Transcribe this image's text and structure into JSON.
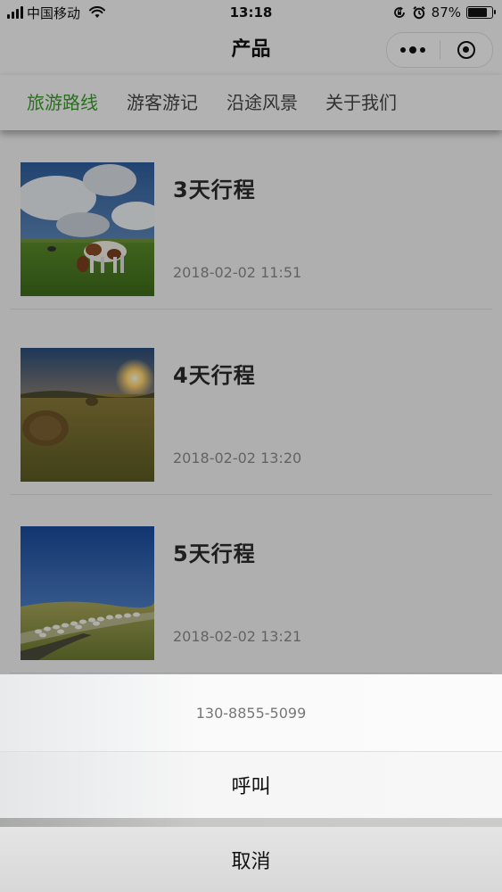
{
  "status_bar": {
    "carrier": "中国移动",
    "time": "13:18",
    "battery_percent": "87%",
    "battery_level": 0.87
  },
  "nav": {
    "title": "产品"
  },
  "tabs": [
    {
      "label": "旅游路线",
      "active": true
    },
    {
      "label": "游客游记",
      "active": false
    },
    {
      "label": "沿途风景",
      "active": false
    },
    {
      "label": "关于我们",
      "active": false
    }
  ],
  "products": [
    {
      "title": "3天行程",
      "date": "2018-02-02 11:51"
    },
    {
      "title": "4天行程",
      "date": "2018-02-02 13:20"
    },
    {
      "title": "5天行程",
      "date": "2018-02-02 13:21"
    }
  ],
  "action_sheet": {
    "phone": "130-8855-5099",
    "call_label": "呼叫",
    "cancel_label": "取消"
  },
  "colors": {
    "accent": "#3a9a2a"
  }
}
